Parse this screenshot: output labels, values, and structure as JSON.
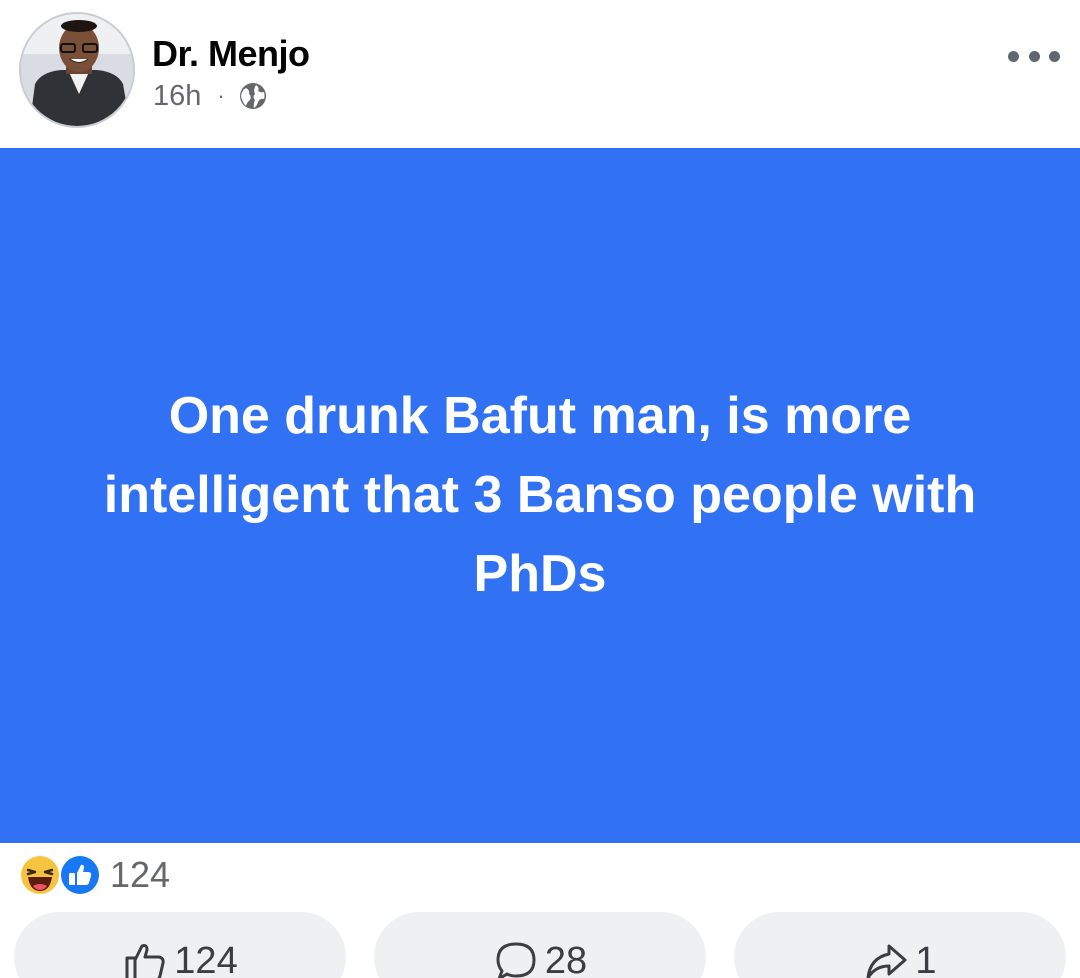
{
  "post": {
    "author": "Dr. Menjo",
    "time": "16h",
    "separator": "·",
    "privacy_icon": "globe-icon",
    "text": "One drunk Bafut man, is more intelligent that 3 Banso people with PhDs",
    "background_color": "#3172f5"
  },
  "reactions": {
    "icons": [
      "haha-reaction-icon",
      "like-reaction-icon"
    ],
    "count": "124"
  },
  "actions": {
    "like_count": "124",
    "comment_count": "28",
    "share_count": "1"
  }
}
